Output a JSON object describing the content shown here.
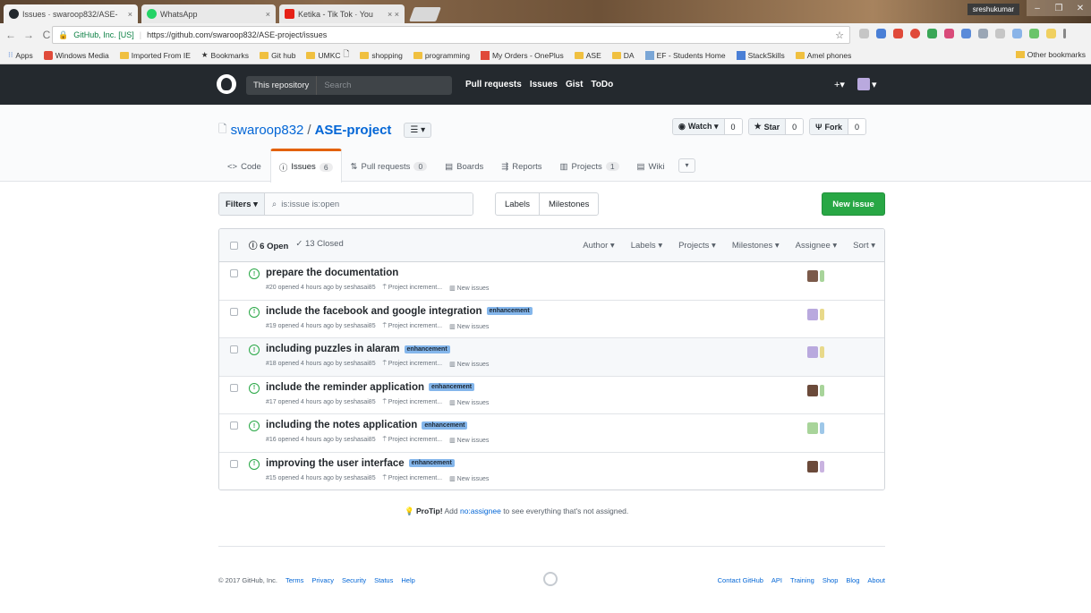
{
  "browser": {
    "tabs": [
      {
        "label": "Issues · swaroop832/ASE-",
        "close": "×",
        "favicon": "#24292e"
      },
      {
        "label": "WhatsApp",
        "close": "×",
        "favicon": "#25d366"
      },
      {
        "label": "Ketika - Tik Tok · You",
        "close": "× ×",
        "favicon": "#e62117"
      }
    ],
    "user": "sreshukumar",
    "window_buttons": [
      "–",
      "❐",
      "✕"
    ],
    "secure_label": "GitHub, Inc. [US]",
    "url": "https://github.com/swaroop832/ASE-project/issues",
    "bookmarks": [
      "Apps",
      "Windows Media",
      "Imported From IE",
      "Bookmarks",
      "Git hub",
      "UMKC",
      "shopping",
      "programming",
      "My Orders - OnePlus",
      "ASE",
      "DA",
      "EF - Students Home",
      "StackSkills",
      "Amel phones"
    ],
    "other_bookmarks": "Other bookmarks"
  },
  "header": {
    "scope": "This repository",
    "search_placeholder": "Search",
    "nav": [
      "Pull requests",
      "Issues",
      "Gist",
      "ToDo"
    ],
    "plus": "+▾",
    "avatar_caret": "▾"
  },
  "repo": {
    "owner": "swaroop832",
    "slash": "/",
    "name": "ASE-project",
    "list_btn": "☰ ▾",
    "watch": {
      "label": "Watch ▾",
      "count": "0"
    },
    "star": {
      "label": "Star",
      "count": "0"
    },
    "fork": {
      "label": "Fork",
      "count": "0"
    },
    "tabs": [
      {
        "icon": "<>",
        "label": "Code",
        "count": ""
      },
      {
        "icon": "ⓘ",
        "label": "Issues",
        "count": "6"
      },
      {
        "icon": "⇅",
        "label": "Pull requests",
        "count": "0"
      },
      {
        "icon": "▤",
        "label": "Boards",
        "count": ""
      },
      {
        "icon": "⇶",
        "label": "Reports",
        "count": ""
      },
      {
        "icon": "▥",
        "label": "Projects",
        "count": "1"
      },
      {
        "icon": "▤",
        "label": "Wiki",
        "count": ""
      }
    ],
    "more": "▾"
  },
  "subnav": {
    "filters": "Filters ▾",
    "search_value": "is:issue is:open",
    "labels": "Labels",
    "milestones": "Milestones",
    "new_issue": "New issue"
  },
  "issues_header": {
    "open": "6 Open",
    "closed": "✓ 13 Closed",
    "filters": [
      "Author ▾",
      "Labels ▾",
      "Projects ▾",
      "Milestones ▾",
      "Assignee ▾",
      "Sort ▾"
    ]
  },
  "issues": [
    {
      "title": "prepare the documentation",
      "label": "",
      "meta": "#20 opened 4 hours ago by seshasai85",
      "project": "Project increment...",
      "column": "New issues",
      "avatar_colors": [
        "#7b5a4a",
        "#a8d49a"
      ]
    },
    {
      "title": "include the facebook and google integration",
      "label": "enhancement",
      "meta": "#19 opened 4 hours ago by seshasai85",
      "project": "Project increment...",
      "column": "New issues",
      "avatar_colors": [
        "#b9a9de",
        "#e8d98a"
      ]
    },
    {
      "title": "including puzzles in alaram",
      "label": "enhancement",
      "meta": "#18 opened 4 hours ago by seshasai85",
      "project": "Project increment...",
      "column": "New issues",
      "avatar_colors": [
        "#b9a9de",
        "#e8d98a"
      ]
    },
    {
      "title": "include the reminder application",
      "label": "enhancement",
      "meta": "#17 opened 4 hours ago by seshasai85",
      "project": "Project increment...",
      "column": "New issues",
      "avatar_colors": [
        "#6b4a3a",
        "#a8d49a"
      ]
    },
    {
      "title": "including the notes application",
      "label": "enhancement",
      "meta": "#16 opened 4 hours ago by seshasai85",
      "project": "Project increment...",
      "column": "New issues",
      "avatar_colors": [
        "#a8d49a",
        "#9ec7e8"
      ]
    },
    {
      "title": "improving the user interface",
      "label": "enhancement",
      "meta": "#15 opened 4 hours ago by seshasai85",
      "project": "Project increment...",
      "column": "New issues",
      "avatar_colors": [
        "#6b4a3a",
        "#c9b3e0"
      ]
    }
  ],
  "protip": {
    "prefix": "ProTip!",
    "text_before": "Add",
    "link": "no:assignee",
    "text_after": "to see everything that's not assigned."
  },
  "footer": {
    "copyright": "© 2017 GitHub, Inc.",
    "left_links": [
      "Terms",
      "Privacy",
      "Security",
      "Status",
      "Help"
    ],
    "right_links": [
      "Contact GitHub",
      "API",
      "Training",
      "Shop",
      "Blog",
      "About"
    ]
  }
}
